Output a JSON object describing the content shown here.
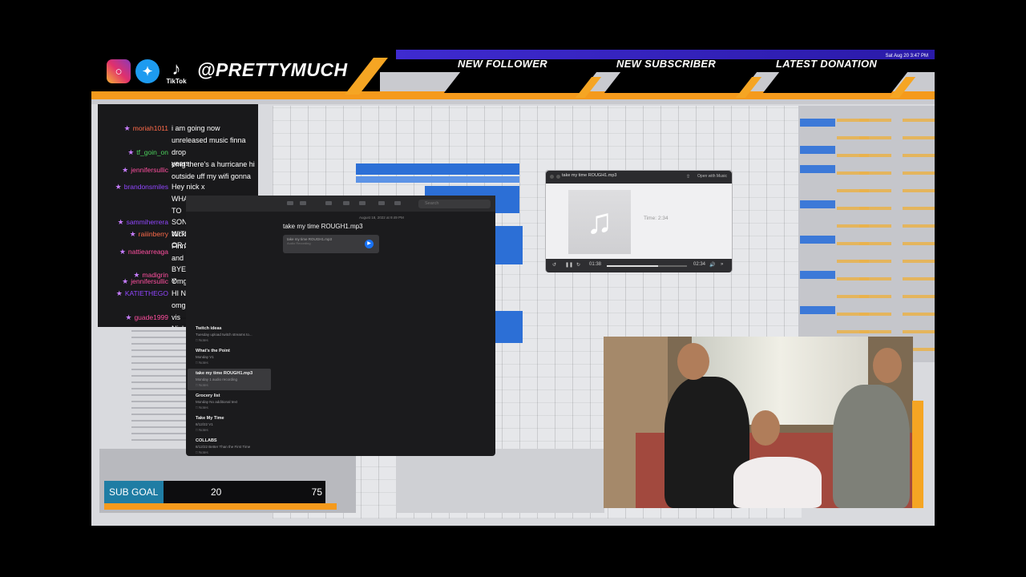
{
  "brand": {
    "handle": "@PRETTYMUCH",
    "tiktok_label": "TikTok"
  },
  "alerts": {
    "new_follower": "NEW FOLLOWER",
    "new_subscriber": "NEW SUBSCRIBER",
    "latest_donation": "LATEST DONATION"
  },
  "menubar": {
    "datetime": "Sat Aug 20  3:47 PM"
  },
  "chat": {
    "messages": [
      {
        "user": "moriah1011",
        "color": "#ff6b4a",
        "text": "i am going now"
      },
      {
        "user": "tf_goin_on",
        "color": "#4bd15c",
        "text": "unreleased music finna drop\nyears"
      },
      {
        "user": "jennifersullic",
        "color": "#ff4fa0",
        "text": "omg there's a hurricane hi\noutside uff my wifi gonna"
      },
      {
        "user": "brandonsmiles",
        "color": "#9146ff",
        "text": "Hey nick x"
      },
      {
        "user": "sammiherrera",
        "color": "#9146ff",
        "text": "WHATEVER HAPPENED TO\nSONG GOES ALONG WITH\nOR SUM SHIII"
      },
      {
        "user": "raiiinberry",
        "color": "#ff6b4a",
        "text": "Nick is out of the basemen"
      },
      {
        "user": "nattiearreaga",
        "color": "#ff4fa0",
        "text": "Finna come get Brandon's\nand release everything 😂"
      },
      {
        "user": "madigrin",
        "color": "#ff4fa0",
        "text": "BYE MOMO I WILL WITH Y"
      },
      {
        "user": "jennifersullic",
        "color": "#ff4fa0",
        "text": "Omg it's a wild thiccolas"
      },
      {
        "user": "KATIETHEGO",
        "color": "#9146ff",
        "text": "HI NICKY @prettymuch"
      },
      {
        "user": "guade1999",
        "color": "#ff4fa0",
        "text": "omg I think I'm having a vis\nNicholas is here"
      }
    ]
  },
  "notes": {
    "search_placeholder": "Search",
    "date": "August 18, 2022 at 9:49 PM",
    "title": "take my time ROUGH1.mp3",
    "attachment": {
      "name": "take my time ROUGH1.mp3",
      "sub": "Audio Recording"
    },
    "list": [
      {
        "title": "Twitch ideas",
        "day": "Tuesday",
        "preview": "upload twitch streams to...",
        "folder": "Notes"
      },
      {
        "title": "What's the Point",
        "day": "Monday",
        "preview": "V1",
        "folder": "Notes"
      },
      {
        "title": "take my time ROUGH1.mp3",
        "day": "Monday",
        "preview": "1 audio recording",
        "folder": "Notes"
      },
      {
        "title": "Grocery list",
        "day": "Monday",
        "preview": "No additional text",
        "folder": "Notes"
      },
      {
        "title": "Take My Time",
        "day": "8/12/22",
        "preview": "V1",
        "folder": "Notes"
      },
      {
        "title": "COLLABS",
        "day": "8/12/22",
        "preview": "Better Than the First Time",
        "folder": "Notes"
      }
    ]
  },
  "player": {
    "filename": "take my time ROUGH1.mp3",
    "open_with": "Open with Music",
    "time_label": "Time: 2:34",
    "elapsed": "01:38",
    "total": "02:34",
    "progress": 0.64
  },
  "sub_goal": {
    "label": "SUB GOAL",
    "current": "20",
    "target": "75"
  },
  "colors": {
    "accent_orange": "#f59a1c",
    "banner_purple": "#3f2bd0",
    "goal_blue": "#1f7da4"
  }
}
